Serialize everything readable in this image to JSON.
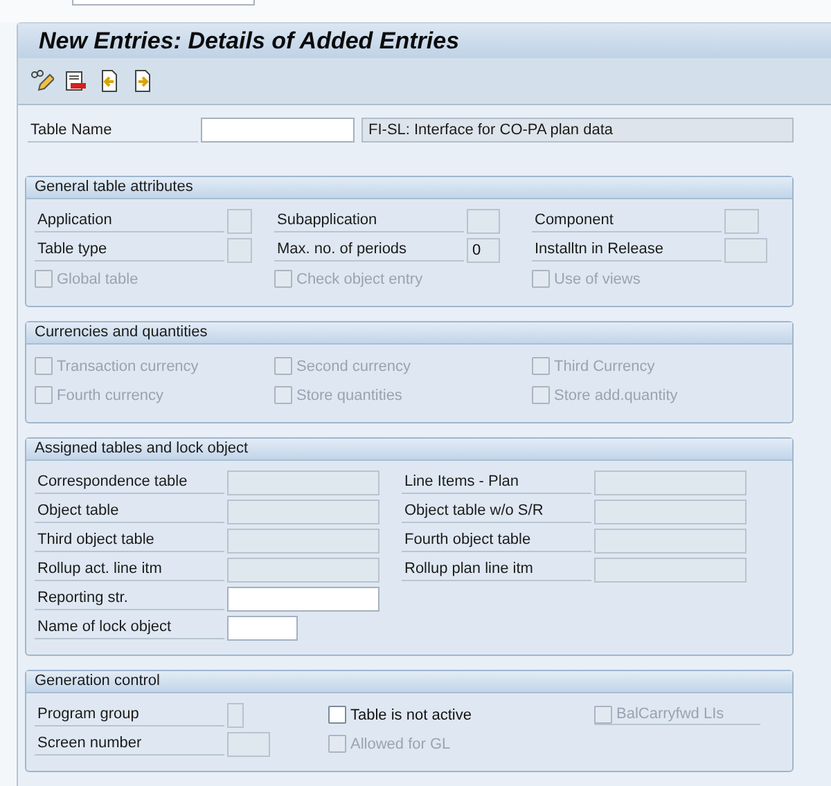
{
  "title": "New Entries: Details of Added Entries",
  "table_name": {
    "label": "Table Name",
    "description": "FI-SL: Interface for CO-PA plan data"
  },
  "groups": [
    {
      "title": "General table attributes",
      "rows": [
        [
          {
            "kind": "field",
            "label": "Application",
            "disabled": true
          },
          {
            "kind": "field",
            "label": "Subapplication",
            "disabled": true
          },
          {
            "kind": "field",
            "label": "Component",
            "disabled": true
          }
        ],
        [
          {
            "kind": "field",
            "label": "Table type",
            "disabled": true
          },
          {
            "kind": "field",
            "label": "Max. no. of periods",
            "value": "0",
            "disabled": true
          },
          {
            "kind": "field",
            "label": "Installtn in Release",
            "disabled": true
          }
        ],
        [
          {
            "kind": "checkbox",
            "label": "Global table",
            "checked": false,
            "disabled": true
          },
          {
            "kind": "checkbox",
            "label": "Check object entry",
            "checked": false,
            "disabled": true
          },
          {
            "kind": "checkbox",
            "label": "Use of views",
            "checked": false,
            "disabled": true
          }
        ]
      ]
    },
    {
      "title": "Currencies and quantities",
      "rows": [
        [
          {
            "kind": "checkbox",
            "label": "Transaction currency",
            "checked": false,
            "disabled": true
          },
          {
            "kind": "checkbox",
            "label": "Second currency",
            "checked": false,
            "disabled": true
          },
          {
            "kind": "checkbox",
            "label": "Third Currency",
            "checked": false,
            "disabled": true
          }
        ],
        [
          {
            "kind": "checkbox",
            "label": "Fourth currency",
            "checked": false,
            "disabled": true
          },
          {
            "kind": "checkbox",
            "label": "Store quantities",
            "checked": false,
            "disabled": true
          },
          {
            "kind": "checkbox",
            "label": "Store add.quantity",
            "checked": false,
            "disabled": true
          }
        ]
      ]
    },
    {
      "title": "Assigned tables and lock object",
      "rows": [
        [
          {
            "kind": "field",
            "label": "Correspondence table",
            "disabled": true
          },
          {
            "kind": "field",
            "label": "Line Items - Plan",
            "disabled": true
          }
        ],
        [
          {
            "kind": "field",
            "label": "Object table",
            "disabled": true
          },
          {
            "kind": "field",
            "label": "Object table w/o S/R",
            "disabled": true
          }
        ],
        [
          {
            "kind": "field",
            "label": "Third object table",
            "disabled": true
          },
          {
            "kind": "field",
            "label": "Fourth object table",
            "disabled": true
          }
        ],
        [
          {
            "kind": "field",
            "label": "Rollup act. line itm",
            "disabled": true
          },
          {
            "kind": "field",
            "label": "Rollup plan line itm",
            "disabled": true
          }
        ],
        [
          {
            "kind": "field",
            "label": "Reporting str.",
            "disabled": false
          }
        ],
        [
          {
            "kind": "field",
            "label": "Name of lock object",
            "disabled": false
          }
        ]
      ]
    },
    {
      "title": "Generation control",
      "rows": [
        [
          {
            "kind": "field",
            "label": "Program group",
            "disabled": true
          },
          {
            "kind": "checkbox",
            "label": "Table is not active",
            "checked": false,
            "disabled": false
          },
          {
            "kind": "checkbox",
            "label": "BalCarryfwd LIs",
            "checked": false,
            "disabled": true
          }
        ],
        [
          {
            "kind": "field",
            "label": "Screen number",
            "disabled": true
          },
          {
            "kind": "checkbox",
            "label": "Allowed for GL",
            "checked": false,
            "disabled": true
          }
        ]
      ]
    }
  ]
}
